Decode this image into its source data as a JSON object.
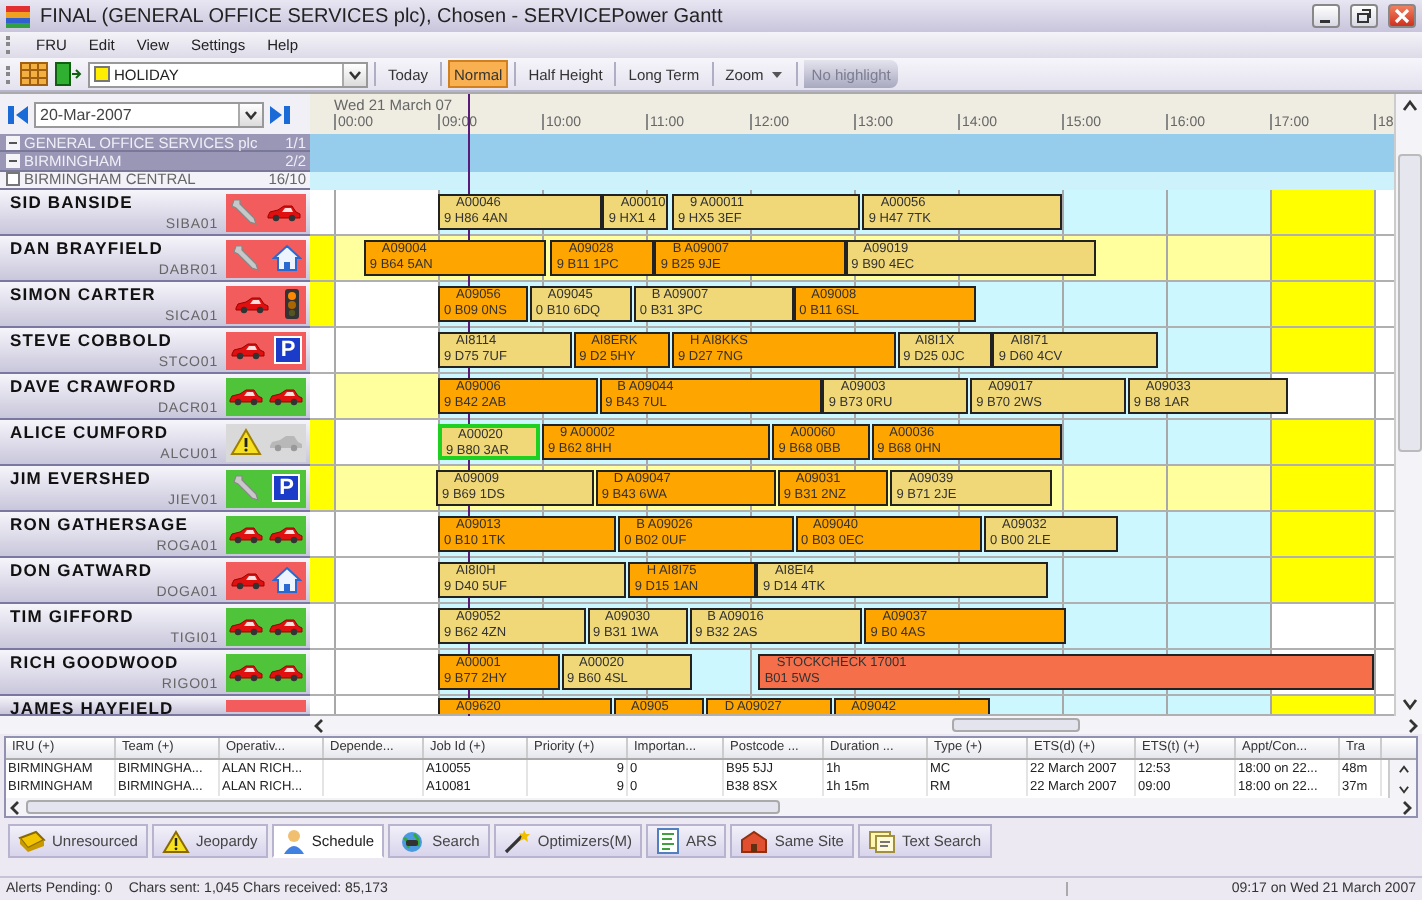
{
  "window": {
    "title": "FINAL (GENERAL OFFICE SERVICES plc), Chosen - SERVICEPower Gantt"
  },
  "menu": [
    "FRU",
    "Edit",
    "View",
    "Settings",
    "Help"
  ],
  "toolbar": {
    "filter": {
      "value": "HOLIDAY"
    },
    "buttons": [
      {
        "label": "Today",
        "kind": "button",
        "selected": false
      },
      {
        "label": "Normal",
        "kind": "button",
        "selected": true
      },
      {
        "label": "Half Height",
        "kind": "button",
        "selected": false
      },
      {
        "label": "Long Term",
        "kind": "button",
        "selected": false
      },
      {
        "label": "Zoom",
        "kind": "dropdown",
        "selected": false
      }
    ],
    "highlight": {
      "label": "No highlight",
      "disabled": true
    }
  },
  "date_nav": {
    "value": "20-Mar-2007"
  },
  "timeline": {
    "day": "Wed 21 March 07",
    "ticks": [
      "00:00",
      "09:00",
      "10:00",
      "11:00",
      "12:00",
      "13:00",
      "14:00",
      "15:00",
      "16:00",
      "17:00",
      "18"
    ]
  },
  "groups": [
    {
      "name": "GENERAL OFFICE SERVICES plc",
      "count": "1/1",
      "kind": "collapsible",
      "expanded": true
    },
    {
      "name": "BIRMINGHAM",
      "count": "2/2",
      "kind": "collapsible",
      "expanded": true
    },
    {
      "name": "BIRMINGHAM CENTRAL",
      "count": "16/10",
      "kind": "checkbox",
      "checked": false
    }
  ],
  "technicians": [
    {
      "name": "SID BANSIDE",
      "code": "SIBA01",
      "color": "#f25c5c",
      "icons": [
        {
          "kind": "wrench"
        },
        {
          "kind": "car"
        }
      ],
      "marker": false,
      "early": false,
      "extended": false,
      "overtime": true,
      "jobs": [
        {
          "id": "A00046",
          "postcode": "9 H86 4AN",
          "color": "#f0d878",
          "selected": false
        },
        {
          "id": "A00010",
          "postcode": "9 HX1 4",
          "color": "#f0d878",
          "selected": false
        },
        {
          "id": "9 A00011",
          "postcode": "9 HX5 3EF",
          "color": "#f0d878",
          "selected": false
        },
        {
          "id": "A00056",
          "postcode": "9 H47 7TK",
          "color": "#f0d878",
          "selected": false
        }
      ]
    },
    {
      "name": "DAN BRAYFIELD",
      "code": "DABR01",
      "color": "#f25c5c",
      "icons": [
        {
          "kind": "wrench"
        },
        {
          "kind": "house"
        }
      ],
      "marker": true,
      "early": true,
      "extended": true,
      "overtime": true,
      "jobs": [
        {
          "id": "A09004",
          "postcode": "9 B64 5AN",
          "color": "#ffa500",
          "selected": false
        },
        {
          "id": "A09028",
          "postcode": "9 B11 1PC",
          "color": "#ffa500",
          "selected": false
        },
        {
          "id": "B A09007",
          "postcode": "9 B25 9JE",
          "color": "#ffa500",
          "selected": false
        },
        {
          "id": "A09019",
          "postcode": "9 B90 4EC",
          "color": "#f0d878",
          "selected": false
        }
      ]
    },
    {
      "name": "SIMON CARTER",
      "code": "SICA01",
      "color": "#f25c5c",
      "icons": [
        {
          "kind": "car"
        },
        {
          "kind": "traffic-light"
        }
      ],
      "marker": true,
      "early": false,
      "extended": false,
      "overtime": true,
      "jobs": [
        {
          "id": "A09056",
          "postcode": "0 B09 0NS",
          "color": "#ffa500",
          "selected": false
        },
        {
          "id": "A09045",
          "postcode": "0 B10 6DQ",
          "color": "#f0d878",
          "selected": false
        },
        {
          "id": "B A09007",
          "postcode": "0 B31 3PC",
          "color": "#f0d878",
          "selected": false
        },
        {
          "id": "A09008",
          "postcode": "0 B11 6SL",
          "color": "#ffa500",
          "selected": false
        }
      ]
    },
    {
      "name": "STEVE COBBOLD",
      "code": "STCO01",
      "color": "#f25c5c",
      "icons": [
        {
          "kind": "car"
        },
        {
          "kind": "parking",
          "label": "P"
        }
      ],
      "marker": false,
      "early": false,
      "extended": false,
      "overtime": true,
      "jobs": [
        {
          "id": "AI8114",
          "postcode": "9 D75 7UF",
          "color": "#f0d878",
          "selected": false
        },
        {
          "id": "AI8ERK",
          "postcode": "9 D2 5HY",
          "color": "#ffa500",
          "selected": false
        },
        {
          "id": "H AI8KKS",
          "postcode": "9 D27 7NG",
          "color": "#ffa500",
          "selected": false
        },
        {
          "id": "AI8I1X",
          "postcode": "9 D25 0JC",
          "color": "#f0d878",
          "selected": false
        },
        {
          "id": "AI8I71",
          "postcode": "9 D60 4CV",
          "color": "#f0d878",
          "selected": false
        }
      ]
    },
    {
      "name": "DAVE CRAWFORD",
      "code": "DACR01",
      "color": "#4fc43a",
      "icons": [
        {
          "kind": "car"
        },
        {
          "kind": "car"
        }
      ],
      "marker": false,
      "early": true,
      "extended": false,
      "overtime": false,
      "jobs": [
        {
          "id": "A09006",
          "postcode": "9 B42 2AB",
          "color": "#ffa500",
          "selected": false
        },
        {
          "id": "B A09044",
          "postcode": "9 B43 7UL",
          "color": "#ffa500",
          "selected": false
        },
        {
          "id": "A09003",
          "postcode": "9 B73 0RU",
          "color": "#f0d878",
          "selected": false
        },
        {
          "id": "A09017",
          "postcode": "9 B70 2WS",
          "color": "#f0d878",
          "selected": false
        },
        {
          "id": "A09033",
          "postcode": "9 B8 1AR",
          "color": "#f0d878",
          "selected": false
        }
      ]
    },
    {
      "name": "ALICE CUMFORD",
      "code": "ALCU01",
      "color": "#d9d9d9",
      "icons": [
        {
          "kind": "warning"
        },
        {
          "kind": "car-faded"
        }
      ],
      "marker": true,
      "early": false,
      "extended": false,
      "overtime": true,
      "jobs": [
        {
          "id": "A00020",
          "postcode": "9 B80 3AR",
          "color": "#f0d878",
          "selected": true
        },
        {
          "id": "9 A00002",
          "postcode": "9 B62 8HH",
          "color": "#ffa500",
          "selected": false
        },
        {
          "id": "A00060",
          "postcode": "9 B68 0BB",
          "color": "#ffa500",
          "selected": false
        },
        {
          "id": "A00036",
          "postcode": "9 B68 0HN",
          "color": "#ffa500",
          "selected": false
        }
      ]
    },
    {
      "name": "JIM EVERSHED",
      "code": "JIEV01",
      "color": "#4fc43a",
      "icons": [
        {
          "kind": "wrench"
        },
        {
          "kind": "parking",
          "label": "P"
        }
      ],
      "marker": true,
      "early": true,
      "extended": true,
      "overtime": true,
      "jobs": [
        {
          "id": "A09009",
          "postcode": "9 B69 1DS",
          "color": "#f0d878",
          "selected": false
        },
        {
          "id": "D A09047",
          "postcode": "9 B43 6WA",
          "color": "#ffa500",
          "selected": false
        },
        {
          "id": "A09031",
          "postcode": "9 B31 2NZ",
          "color": "#ffa500",
          "selected": false
        },
        {
          "id": "A09039",
          "postcode": "9 B71 2JE",
          "color": "#f0d878",
          "selected": false
        }
      ]
    },
    {
      "name": "RON GATHERSAGE",
      "code": "ROGA01",
      "color": "#4fc43a",
      "icons": [
        {
          "kind": "car"
        },
        {
          "kind": "car"
        }
      ],
      "marker": false,
      "early": false,
      "extended": false,
      "overtime": true,
      "jobs": [
        {
          "id": "A09013",
          "postcode": "0 B10 1TK",
          "color": "#ffa500",
          "selected": false
        },
        {
          "id": "B A09026",
          "postcode": "0 B02 0UF",
          "color": "#ffa500",
          "selected": false
        },
        {
          "id": "A09040",
          "postcode": "0 B03 0EC",
          "color": "#ffa500",
          "selected": false
        },
        {
          "id": "A09032",
          "postcode": "0 B00 2LE",
          "color": "#f0d878",
          "selected": false
        }
      ]
    },
    {
      "name": "DON GATWARD",
      "code": "DOGA01",
      "color": "#f25c5c",
      "icons": [
        {
          "kind": "car"
        },
        {
          "kind": "house"
        }
      ],
      "marker": true,
      "early": false,
      "extended": false,
      "overtime": true,
      "jobs": [
        {
          "id": "AI8I0H",
          "postcode": "9 D40 5UF",
          "color": "#f0d878",
          "selected": false
        },
        {
          "id": "H AI8I75",
          "postcode": "9 D15 1AN",
          "color": "#ffa500",
          "selected": false
        },
        {
          "id": "AI8EI4",
          "postcode": "9 D14 4TK",
          "color": "#f0d878",
          "selected": false
        }
      ]
    },
    {
      "name": "TIM GIFFORD",
      "code": "TIGI01",
      "color": "#4fc43a",
      "icons": [
        {
          "kind": "car"
        },
        {
          "kind": "car"
        }
      ],
      "marker": false,
      "early": false,
      "extended": false,
      "overtime": false,
      "jobs": [
        {
          "id": "A09052",
          "postcode": "9 B62 4ZN",
          "color": "#f0d878",
          "selected": false
        },
        {
          "id": "A09030",
          "postcode": "9 B31 1WA",
          "color": "#f0d878",
          "selected": false
        },
        {
          "id": "B A09016",
          "postcode": "9 B32 2AS",
          "color": "#f0d878",
          "selected": false
        },
        {
          "id": "A09037",
          "postcode": "9 B0 4AS",
          "color": "#ffa500",
          "selected": false
        }
      ]
    },
    {
      "name": "RICH GOODWOOD",
      "code": "RIGO01",
      "color": "#4fc43a",
      "icons": [
        {
          "kind": "car"
        },
        {
          "kind": "car"
        }
      ],
      "marker": false,
      "early": false,
      "extended": false,
      "overtime": false,
      "jobs": [
        {
          "id": "A00001",
          "postcode": "9 B77 2HY",
          "color": "#ffa500",
          "selected": false
        },
        {
          "id": "A00020",
          "postcode": "9 B60 4SL",
          "color": "#f0d878",
          "selected": false
        },
        {
          "id": "STOCKCHECK 17001",
          "postcode": "B01 5WS",
          "color": "#f5704a",
          "selected": false
        }
      ]
    },
    {
      "name": "JAMES HAYFIELD",
      "color": "#f25c5c",
      "marker": false,
      "early": false,
      "extended": false,
      "overtime": true,
      "jobs": [
        {
          "id": "A09620",
          "color": "#ffa500",
          "selected": false
        },
        {
          "id": "A0905",
          "color": "#ffa500",
          "selected": false
        },
        {
          "id": "D A09027",
          "color": "#ffa500",
          "selected": false
        },
        {
          "id": "A09042",
          "color": "#ffa500",
          "selected": false
        }
      ]
    }
  ],
  "table": {
    "columns": [
      "IRU (+)",
      "Team (+)",
      "Operativ...",
      "Depende...",
      "Job Id (+)",
      "Priority (+)",
      "Importan...",
      "Postcode ...",
      "Duration ...",
      "Type (+)",
      "ETS(d) (+)",
      "ETS(t) (+)",
      "Appt/Con...",
      "Tra"
    ],
    "rows": [
      [
        "BIRMINGHAM",
        "BIRMINGHA...",
        "ALAN RICH...",
        null,
        "A10055",
        "9",
        "0",
        "B95 5JJ",
        "1h",
        "MC",
        "22 March 2007",
        "12:53",
        "18:00 on 22...",
        "48m"
      ],
      [
        "BIRMINGHAM",
        "BIRMINGHA...",
        "ALAN RICH...",
        null,
        "A10081",
        "9",
        "0",
        "B38 8SX",
        "1h 15m",
        "RM",
        "22 March 2007",
        "09:00",
        "18:00 on 22...",
        "37m"
      ]
    ]
  },
  "tabs": [
    {
      "label": "Unresourced",
      "selected": false
    },
    {
      "label": "Jeopardy",
      "selected": false
    },
    {
      "label": "Schedule",
      "selected": true
    },
    {
      "label": "Search",
      "selected": false
    },
    {
      "label": "Optimizers(M)",
      "selected": false
    },
    {
      "label": "ARS",
      "selected": false
    },
    {
      "label": "Same Site",
      "selected": false
    },
    {
      "label": "Text Search",
      "selected": false
    }
  ],
  "status_bar": {
    "alerts": "Alerts Pending: 0",
    "counters": "Chars sent: 1,045 Chars received: 85,173",
    "clock": "09:17 on Wed 21 March 2007"
  }
}
